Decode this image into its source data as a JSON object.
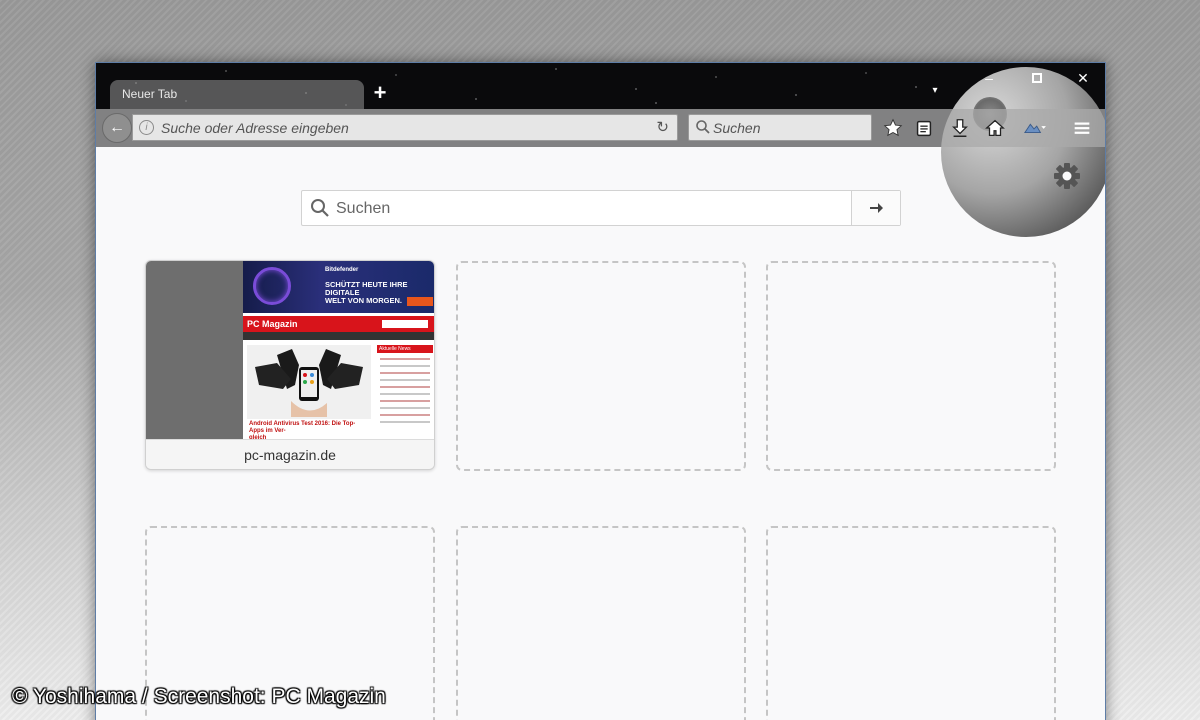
{
  "window": {
    "tab_title": "Neuer Tab",
    "new_tab_label": "+",
    "tab_menu_glyph": "▾",
    "controls": {
      "minimize": "–",
      "maximize": "",
      "close": "✕"
    },
    "theme_colors": {
      "accent_border": "#5e7da6",
      "titlebar_bg": "#0a0a0c"
    }
  },
  "navbar": {
    "back_glyph": "←",
    "info_glyph": "i",
    "url_placeholder": "Suche oder Adresse eingeben",
    "reload_glyph": "↻",
    "search_placeholder": "Suchen",
    "toolbar_icons": [
      "star-icon",
      "reading-list-icon",
      "download-icon",
      "home-icon",
      "extension-icon",
      "menu-icon"
    ]
  },
  "newtab": {
    "search_placeholder": "Suchen",
    "go_icon": "arrow-right-icon",
    "settings_icon": "gear-icon",
    "tiles": [
      {
        "label": "pc-magazin.de",
        "thumbnail": {
          "banner_brand": "Bitdefender",
          "banner_line1": "SCHÜTZT HEUTE IHRE DIGITALE",
          "banner_line2": "WELT VON MORGEN.",
          "site_logo": "PC Magazin",
          "sidebar_heading": "Aktuelle News",
          "headline_line1": "Android Antivirus Test 2016: Die Top-Apps im Ver-",
          "headline_line2": "gleich"
        }
      },
      {
        "label": ""
      },
      {
        "label": ""
      },
      {
        "label": ""
      },
      {
        "label": ""
      },
      {
        "label": ""
      }
    ]
  },
  "watermark": "© Yoshihama / Screenshot: PC Magazin"
}
